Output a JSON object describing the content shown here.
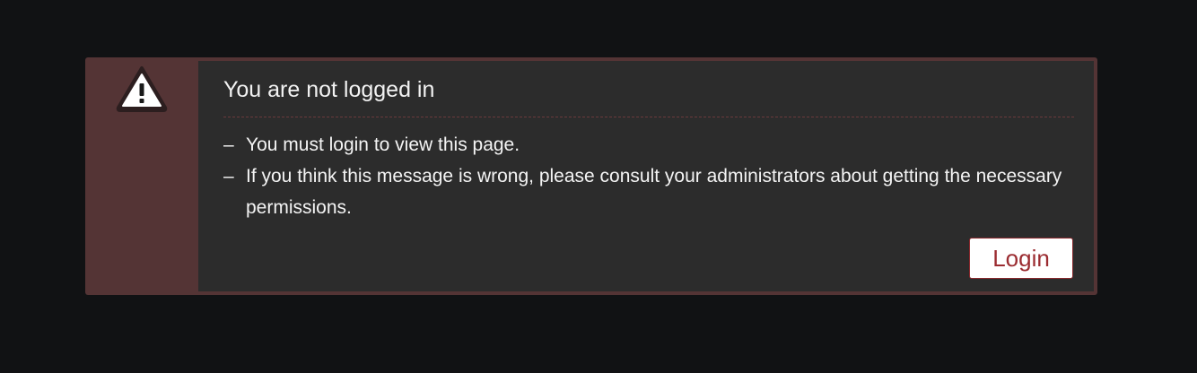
{
  "alert": {
    "icon": "warning-triangle-icon",
    "title": "You are not logged in",
    "messages": [
      "You must login to view this page.",
      "If you think this message is wrong, please consult your administrators about getting the necessary permissions."
    ],
    "bullet": "–",
    "login_label": "Login"
  },
  "colors": {
    "page_background": "#111214",
    "alert_accent": "#543435",
    "alert_body": "#2c2c2c",
    "button_text": "#9b2c31"
  }
}
